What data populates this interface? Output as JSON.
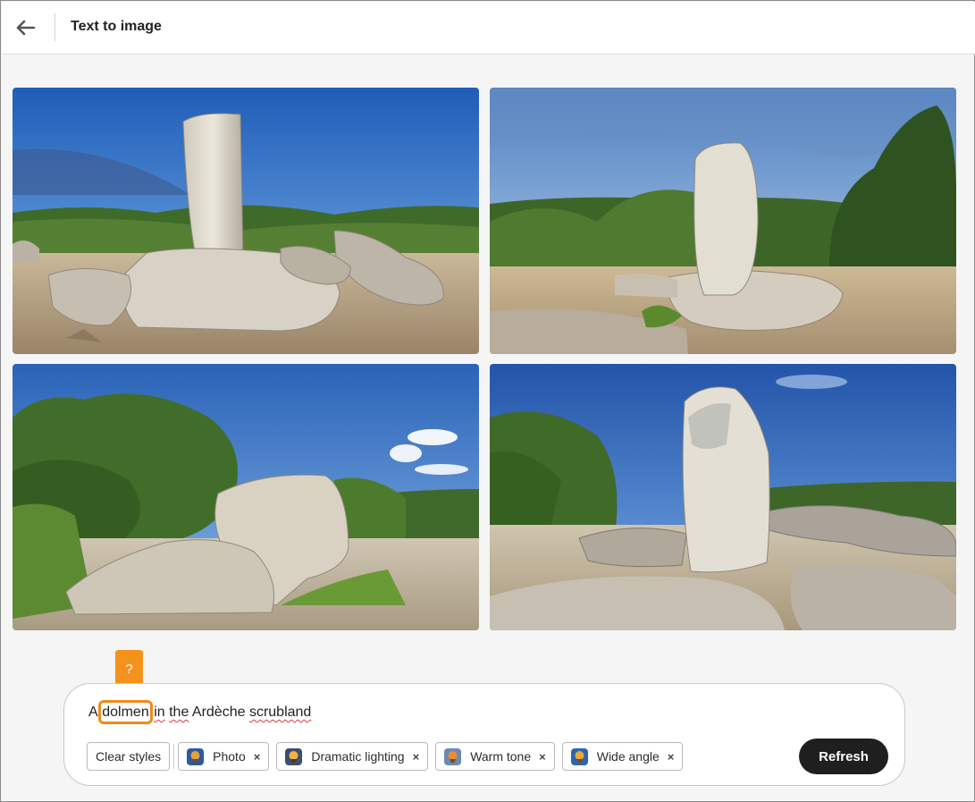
{
  "header": {
    "back_icon": "arrow-left-icon",
    "title": "Text to image"
  },
  "gallery": {
    "images": [
      {
        "description_icon": "generated-image"
      },
      {
        "description_icon": "generated-image"
      },
      {
        "description_icon": "generated-image"
      },
      {
        "description_icon": "generated-image"
      }
    ]
  },
  "prompt": {
    "word_a": "A",
    "word_highlight": "dolmen",
    "word_in": "in",
    "word_the": "the",
    "word_ardeche": "Ardèche",
    "word_scrubland": "scrubland",
    "hint_badge": "?"
  },
  "styles": {
    "clear_label": "Clear styles",
    "chips": [
      {
        "label": "Photo",
        "remove": "×"
      },
      {
        "label": "Dramatic lighting",
        "remove": "×"
      },
      {
        "label": "Warm tone",
        "remove": "×"
      },
      {
        "label": "Wide angle",
        "remove": "×"
      }
    ]
  },
  "actions": {
    "refresh_label": "Refresh"
  },
  "colors": {
    "accent_orange": "#f08a1c",
    "button_dark": "#1f1f1f",
    "sky_blue": "#2f6fc4"
  }
}
